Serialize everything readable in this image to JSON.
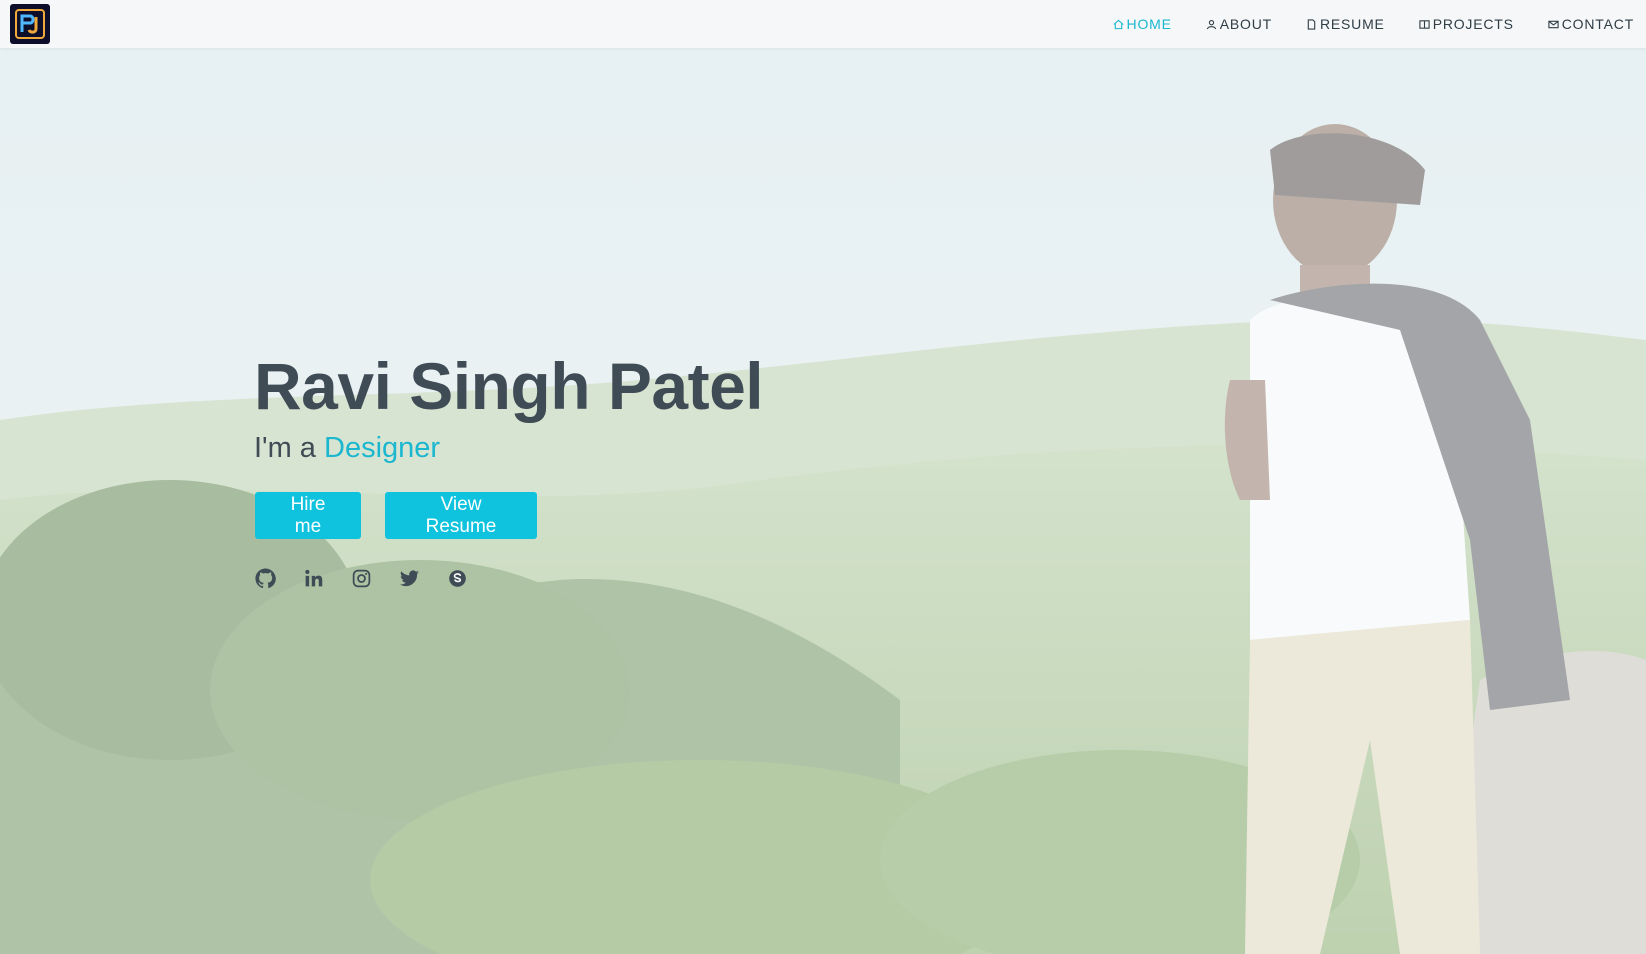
{
  "header": {
    "logo_icon": "rj-monogram-logo",
    "nav": [
      {
        "label": "HOME",
        "icon": "home-icon",
        "active": true
      },
      {
        "label": "ABOUT",
        "icon": "user-icon",
        "active": false
      },
      {
        "label": "RESUME",
        "icon": "file-icon",
        "active": false
      },
      {
        "label": "PROJECTS",
        "icon": "book-icon",
        "active": false
      },
      {
        "label": "CONTACT",
        "icon": "envelope-icon",
        "active": false
      }
    ]
  },
  "hero": {
    "name": "Ravi Singh Patel",
    "intro_prefix": "I'm a",
    "role": "Designer",
    "buttons": {
      "hire": "Hire me",
      "resume": "View Resume"
    },
    "socials": [
      "github-icon",
      "linkedin-icon",
      "instagram-icon",
      "twitter-icon",
      "skype-icon"
    ]
  },
  "colors": {
    "accent": "#1ab7cf",
    "button": "#0fc3de",
    "text_dark": "#3f4c55",
    "header_bg": "#f6f7f9"
  }
}
